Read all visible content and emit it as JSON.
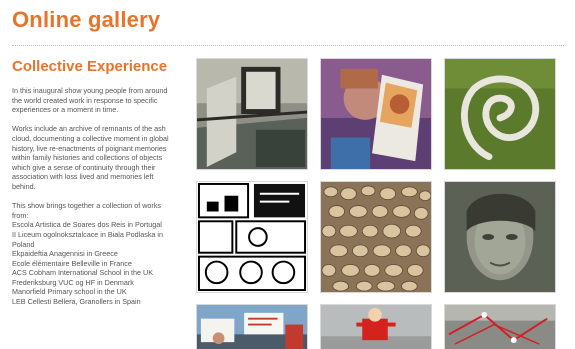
{
  "header": {
    "title": "Online gallery"
  },
  "section": {
    "title": "Collective Experience"
  },
  "description": {
    "paragraphs": [
      "In this inaugural show young people from around the world created work in response to specific experiences or a moment in time.",
      "Works include an archive of remnants of the ash cloud, documenting a collective moment in global history, live re-enactments of poignant memories within family histories and collections of objects which give a sense of continuity through their association with loss lived and memories left behind.",
      "This show brings together a collection of works from:"
    ],
    "schools": [
      "Escola Artistica de Soares dos Reis in Portugal",
      "II Liceum ogolnoksztalcace in Biala Podlaska in Poland",
      "Ekpaideftia Anagennisi in Greece",
      "Ecole élémentaire Belleville in France",
      "ACS Cobham International School in the UK",
      "Frederiksburg VUC og HF in Denmark",
      "Manorfield Primary school in the UK",
      "LEB Cellesti Bellera, Granollers in Spain"
    ]
  },
  "gallery": {
    "tiles": [
      {
        "icon": "framed-picture-on-table-photo"
      },
      {
        "icon": "child-behind-photo-photo"
      },
      {
        "icon": "shoe-spiral-on-grass-photo"
      },
      {
        "icon": "comic-strip-drawing"
      },
      {
        "icon": "pebbles-texture-photo"
      },
      {
        "icon": "overlaid-face-portrait-photo"
      },
      {
        "icon": "protest-signs-photo"
      },
      {
        "icon": "red-toy-figure-photo"
      },
      {
        "icon": "red-thread-installation-photo"
      }
    ]
  }
}
